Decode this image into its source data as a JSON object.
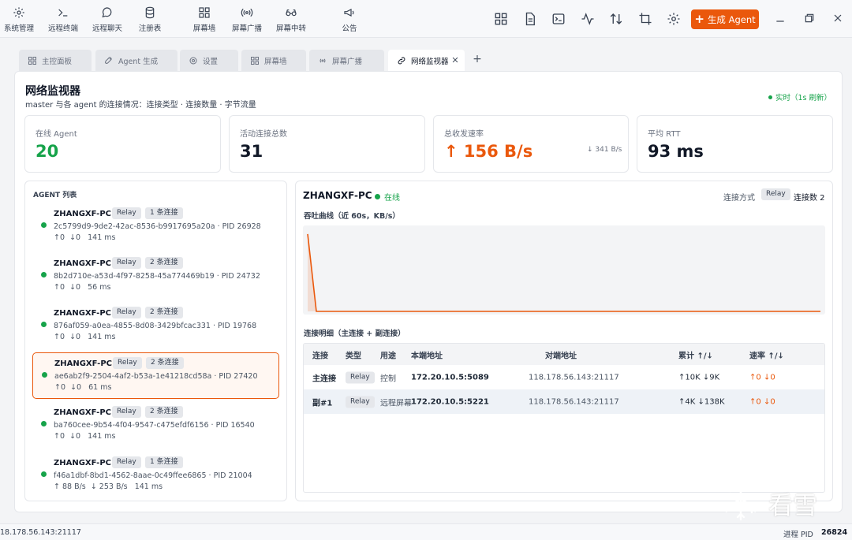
{
  "nav": [
    {
      "label": "系统管理",
      "icon": "gear-icon"
    },
    {
      "label": "远程终端",
      "icon": "terminal-icon"
    },
    {
      "label": "远程聊天",
      "icon": "chat-bubble-icon"
    },
    {
      "label": "注册表",
      "icon": "database-icon"
    },
    {
      "label": "屏幕墙",
      "icon": "grid-icon"
    },
    {
      "label": "屏幕广播",
      "icon": "broadcast-icon"
    },
    {
      "label": "屏幕中转",
      "icon": "relay-glasses-icon"
    },
    {
      "label": "公告",
      "icon": "megaphone-icon"
    }
  ],
  "toolbar": {
    "icons": [
      "layout-grid-icon",
      "document-icon",
      "terminal-box-icon",
      "activity-icon",
      "transfer-arrows-icon",
      "crop-icon",
      "settings-icon"
    ],
    "generate_label": "生成 Agent",
    "window": [
      "minimize-icon",
      "restore-icon",
      "close-icon"
    ]
  },
  "tabs": [
    {
      "label": "主控面板",
      "icon": "dashboard-icon",
      "active": false
    },
    {
      "label": "Agent 生成",
      "icon": "rocket-icon",
      "active": false
    },
    {
      "label": "设置",
      "icon": "gear-icon",
      "active": false
    },
    {
      "label": "屏幕墙",
      "icon": "grid-icon",
      "active": false
    },
    {
      "label": "屏幕广播",
      "icon": "broadcast-icon",
      "active": false
    },
    {
      "label": "网络监视器",
      "icon": "link-icon",
      "active": true
    }
  ],
  "page": {
    "title": "网络监视器",
    "subtitle": "master 与各 agent 的连接情况：连接类型 · 连接数量 · 字节流量",
    "live": "实时（1s 刷新）"
  },
  "stats": {
    "online_label": "在线 Agent",
    "online_value": "20",
    "conn_label": "活动连接总数",
    "conn_value": "31",
    "rate_label": "总收发速率",
    "rate_value": "↑ 156 B/s",
    "rate_down": "↓ 341 B/s",
    "rtt_label": "平均 RTT",
    "rtt_value": "93 ms"
  },
  "agents": {
    "header": "AGENT 列表",
    "items": [
      {
        "name": "ZHANGXF-PC",
        "type": "Relay",
        "conns": "1 条连接",
        "id": "2c5799d9-9de2-42ac-8536-b9917695a20a",
        "pid": "PID 26928",
        "up": "↑0",
        "down": "↓0",
        "rtt": "141 ms",
        "selected": false
      },
      {
        "name": "ZHANGXF-PC",
        "type": "Relay",
        "conns": "2 条连接",
        "id": "8b2d710e-a53d-4f97-8258-45a774469b19",
        "pid": "PID 24732",
        "up": "↑0",
        "down": "↓0",
        "rtt": "56 ms",
        "selected": false
      },
      {
        "name": "ZHANGXF-PC",
        "type": "Relay",
        "conns": "2 条连接",
        "id": "876af059-a0ea-4855-8d08-3429bfcac331",
        "pid": "PID 19768",
        "up": "↑0",
        "down": "↓0",
        "rtt": "141 ms",
        "selected": false
      },
      {
        "name": "ZHANGXF-PC",
        "type": "Relay",
        "conns": "2 条连接",
        "id": "ae6ab2f9-2504-4af2-b53a-1e41218cd58a",
        "pid": "PID 27420",
        "up": "↑0",
        "down": "↓0",
        "rtt": "61 ms",
        "selected": true
      },
      {
        "name": "ZHANGXF-PC",
        "type": "Relay",
        "conns": "2 条连接",
        "id": "ba760cee-9b54-4f04-9547-c475efdf6156",
        "pid": "PID 16540",
        "up": "↑0",
        "down": "↓0",
        "rtt": "141 ms",
        "selected": false
      },
      {
        "name": "ZHANGXF-PC",
        "type": "Relay",
        "conns": "1 条连接",
        "id": "f46a1dbf-8bd1-4562-8aae-0c49ffee6865",
        "pid": "PID 21004",
        "up": "↑ 88 B/s",
        "down": "↓ 253 B/s",
        "rtt": "141 ms",
        "selected": false
      }
    ]
  },
  "detail": {
    "name": "ZHANGXF-PC",
    "status": "在线",
    "mode_label": "连接方式",
    "mode": "Relay",
    "count_label": "连接数 2",
    "chart_title": "吞吐曲线（近 60s，KB/s）",
    "conn_title": "连接明细（主连接 + 副连接）",
    "columns": [
      "连接",
      "类型",
      "用途",
      "本端地址",
      "对端地址",
      "累计 ↑/↓",
      "速率 ↑/↓"
    ],
    "rows": [
      {
        "conn": "主连接",
        "type": "Relay",
        "use": "控制",
        "local": "172.20.10.5:5089",
        "remote": "118.178.56.143:21117",
        "total_up": "↑10K",
        "total_down": "↓9K",
        "rate_up": "↑0",
        "rate_down": "↓0"
      },
      {
        "conn": "副#1",
        "type": "Relay",
        "use": "远程屏幕",
        "local": "172.20.10.5:5221",
        "remote": "118.178.56.143:21117",
        "total_up": "↑4K",
        "total_down": "↓138K",
        "rate_up": "↑0",
        "rate_down": "↓0"
      }
    ]
  },
  "chart_data": {
    "type": "area",
    "title": "吞吐曲线（近 60s，KB/s）",
    "values": [
      95,
      0,
      0,
      0,
      0,
      0,
      0,
      0,
      0,
      0,
      0,
      0,
      0,
      0,
      0,
      0,
      0,
      0,
      0,
      0,
      0,
      0,
      0,
      0,
      0,
      0,
      0,
      0,
      0,
      0,
      0,
      0,
      0,
      0,
      0,
      0,
      0,
      0,
      0,
      0,
      0,
      0,
      0,
      0,
      0,
      0,
      0,
      0,
      0,
      0,
      0,
      0,
      0,
      0,
      0,
      0,
      0,
      0,
      0,
      0
    ],
    "color": "#ea580c",
    "grid": false
  },
  "status_bar": {
    "address": "18.178.56.143:21117",
    "pid_label": "进程 PID",
    "pid": "26824"
  },
  "watermark": "看雪",
  "colors": {
    "accent": "#ea580c",
    "online": "#16a34a"
  }
}
